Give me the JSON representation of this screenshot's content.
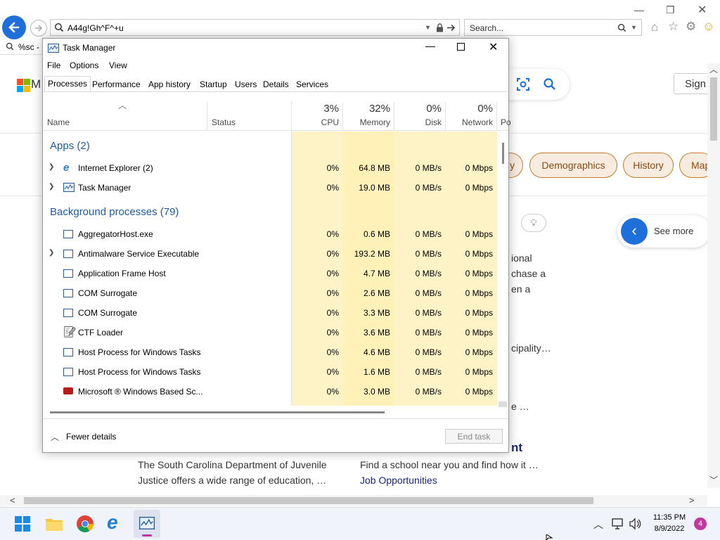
{
  "browser": {
    "address": "A44g!Gh^F^+u",
    "search_placeholder": "Search...",
    "tab_label": "%sc - S"
  },
  "web": {
    "sign_in": "Sign i",
    "chips": [
      "y",
      "Demographics",
      "History",
      "Map"
    ],
    "see_more": "See more",
    "frag1": "ional",
    "frag2": "chase a",
    "frag3": "en a",
    "frag4": "cipality…",
    "frag5": "e …",
    "heading_frag": "nt",
    "text1a": "The South Carolina Department of Juvenile",
    "text1b": "Justice offers a wide range of education, …",
    "text2a": "Find a school near you and find how it …",
    "text2b": "Job Opportunities"
  },
  "tm": {
    "title": "Task Manager",
    "menu": [
      "File",
      "Options",
      "View"
    ],
    "tabs": [
      "Processes",
      "Performance",
      "App history",
      "Startup",
      "Users",
      "Details",
      "Services"
    ],
    "headers": {
      "name": "Name",
      "status": "Status",
      "cpu_pct": "3%",
      "cpu": "CPU",
      "mem_pct": "32%",
      "mem": "Memory",
      "disk_pct": "0%",
      "disk": "Disk",
      "net_pct": "0%",
      "net": "Network",
      "power": "Po"
    },
    "group_apps": "Apps (2)",
    "group_bg": "Background processes (79)",
    "apps": [
      {
        "name": "Internet Explorer (2)",
        "cpu": "0%",
        "mem": "64.8 MB",
        "disk": "0 MB/s",
        "net": "0 Mbps"
      },
      {
        "name": "Task Manager",
        "cpu": "0%",
        "mem": "19.0 MB",
        "disk": "0 MB/s",
        "net": "0 Mbps"
      }
    ],
    "procs": [
      {
        "name": "AggregatorHost.exe",
        "cpu": "0%",
        "mem": "0.6 MB",
        "disk": "0 MB/s",
        "net": "0 Mbps"
      },
      {
        "name": "Antimalware Service Executable",
        "cpu": "0%",
        "mem": "193.2 MB",
        "disk": "0 MB/s",
        "net": "0 Mbps"
      },
      {
        "name": "Application Frame Host",
        "cpu": "0%",
        "mem": "4.7 MB",
        "disk": "0 MB/s",
        "net": "0 Mbps"
      },
      {
        "name": "COM Surrogate",
        "cpu": "0%",
        "mem": "2.6 MB",
        "disk": "0 MB/s",
        "net": "0 Mbps"
      },
      {
        "name": "COM Surrogate",
        "cpu": "0%",
        "mem": "3.3 MB",
        "disk": "0 MB/s",
        "net": "0 Mbps"
      },
      {
        "name": "CTF Loader",
        "cpu": "0%",
        "mem": "3.6 MB",
        "disk": "0 MB/s",
        "net": "0 Mbps"
      },
      {
        "name": "Host Process for Windows Tasks",
        "cpu": "0%",
        "mem": "4.6 MB",
        "disk": "0 MB/s",
        "net": "0 Mbps"
      },
      {
        "name": "Host Process for Windows Tasks",
        "cpu": "0%",
        "mem": "1.6 MB",
        "disk": "0 MB/s",
        "net": "0 Mbps"
      },
      {
        "name": "Microsoft ® Windows Based Sc...",
        "cpu": "0%",
        "mem": "3.0 MB",
        "disk": "0 MB/s",
        "net": "0 Mbps"
      }
    ],
    "fewer_details": "Fewer details",
    "end_task": "End task"
  },
  "taskbar": {
    "time": "11:35 PM",
    "date": "8/9/2022",
    "notif_count": "4"
  }
}
